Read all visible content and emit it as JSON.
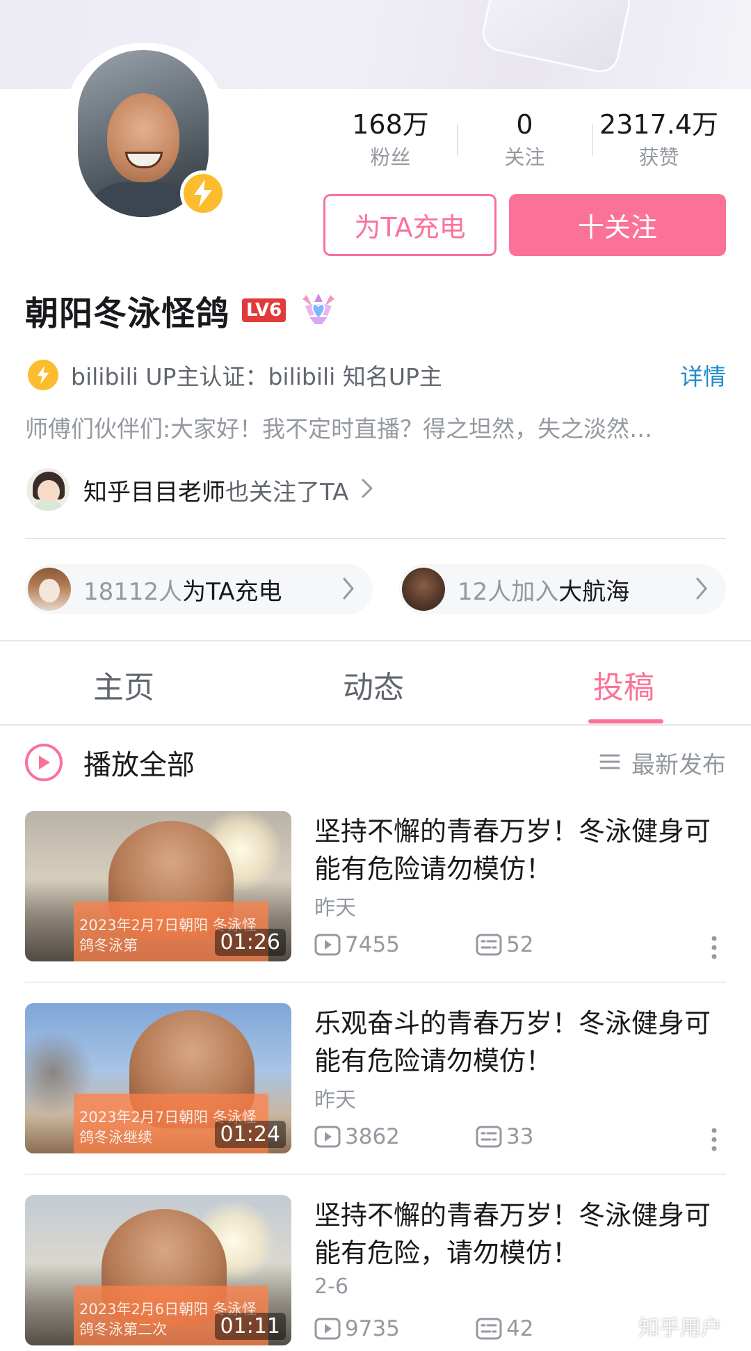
{
  "profile": {
    "name": "朝阳冬泳怪鸽",
    "level_badge": "LV6",
    "stats": [
      {
        "value": "168万",
        "label": "粉丝"
      },
      {
        "value": "0",
        "label": "关注"
      },
      {
        "value": "2317.4万",
        "label": "获赞"
      }
    ],
    "charge_button": "为TA充电",
    "follow_button": "十关注",
    "verify_text": "bilibili UP主认证：bilibili 知名UP主",
    "verify_detail": "详情",
    "bio": "师傅们伙伴们:大家好！我不定时直播？得之坦然，失之淡然…",
    "mutual_name": "知乎目目老师",
    "mutual_suffix": "也关注了TA",
    "charge_count": "18112人",
    "charge_suffix": "为TA充电",
    "fleet_count": "12人加入",
    "fleet_suffix": "大航海"
  },
  "tabs": [
    "主页",
    "动态",
    "投稿"
  ],
  "active_tab": "投稿",
  "list_header": {
    "play_all": "播放全部",
    "sort": "最新发布"
  },
  "videos": [
    {
      "title": "坚持不懈的青春万岁！冬泳健身可能有危险请勿模仿！",
      "date": "昨天",
      "views": "7455",
      "danmaku": "52",
      "duration": "01:26",
      "thumb_caption": "2023年2月7日朝阳 冬泳怪鸽冬泳第"
    },
    {
      "title": "乐观奋斗的青春万岁！冬泳健身可能有危险请勿模仿！",
      "date": "昨天",
      "views": "3862",
      "danmaku": "33",
      "duration": "01:24",
      "thumb_caption": "2023年2月7日朝阳 冬泳怪鸽冬泳继续"
    },
    {
      "title": "坚持不懈的青春万岁！冬泳健身可能有危险，请勿模仿！",
      "date": "2-6",
      "views": "9735",
      "danmaku": "42",
      "duration": "01:11",
      "thumb_caption": "2023年2月6日朝阳 冬泳怪鸽冬泳第二次"
    }
  ],
  "watermark": "知乎用户",
  "colors": {
    "accent": "#fb7299",
    "link": "#1e8bcd",
    "text_primary": "#18191c",
    "text_secondary": "#9499a0",
    "bolt_yellow": "#fbbd2e",
    "level_red": "#e23a3a"
  },
  "icons": [
    "lightning-bolt-icon",
    "medal-icon",
    "chevron-right-icon",
    "play-circle-icon",
    "sort-list-icon",
    "play-count-icon",
    "danmaku-icon",
    "more-vertical-icon"
  ]
}
